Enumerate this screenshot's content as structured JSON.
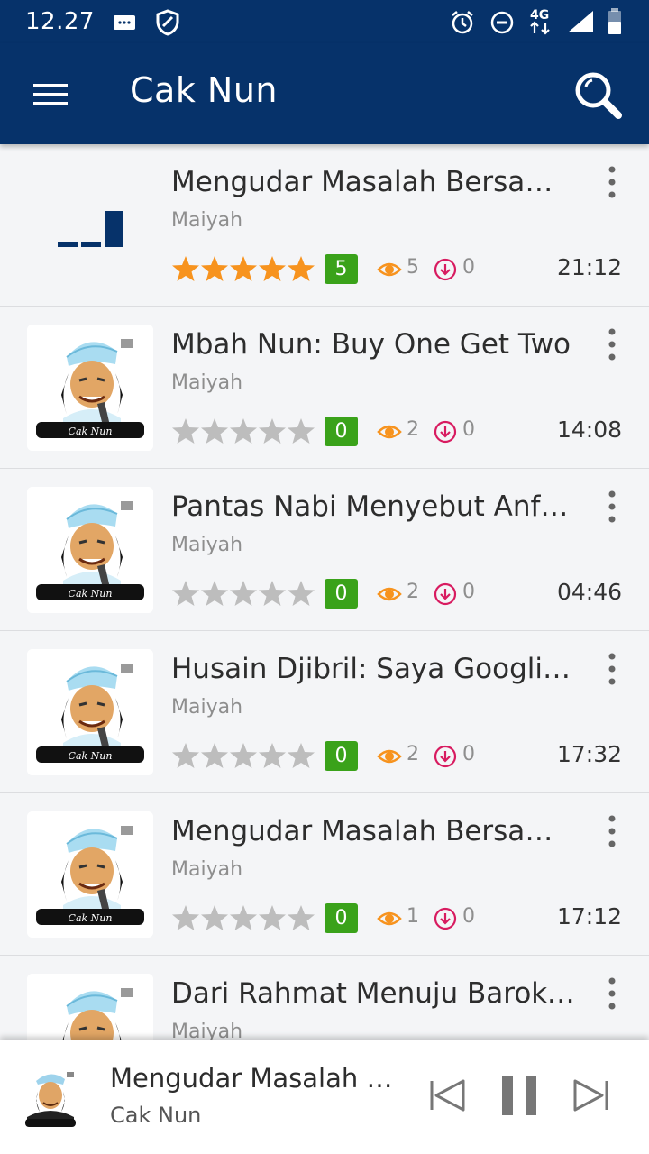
{
  "status_bar": {
    "time": "12.27",
    "network": "4G"
  },
  "app_bar": {
    "title": "Cak Nun"
  },
  "tracks": [
    {
      "title": "Mengudar Masalah Bersam...",
      "subtitle": "Maiyah",
      "rating": 5,
      "rating_label": "5",
      "views": "5",
      "downloads": "0",
      "duration": "21:12",
      "thumb": "bars-icon"
    },
    {
      "title": "Mbah Nun: Buy One Get Two",
      "subtitle": "Maiyah",
      "rating": 0,
      "rating_label": "0",
      "views": "2",
      "downloads": "0",
      "duration": "14:08",
      "thumb": "portrait"
    },
    {
      "title": "Pantas Nabi Menyebut Anfa...",
      "subtitle": "Maiyah",
      "rating": 0,
      "rating_label": "0",
      "views": "2",
      "downloads": "0",
      "duration": "04:46",
      "thumb": "portrait"
    },
    {
      "title": "Husain Djibril: Saya Googling...",
      "subtitle": "Maiyah",
      "rating": 0,
      "rating_label": "0",
      "views": "2",
      "downloads": "0",
      "duration": "17:32",
      "thumb": "portrait"
    },
    {
      "title": "Mengudar Masalah Bersam...",
      "subtitle": "Maiyah",
      "rating": 0,
      "rating_label": "0",
      "views": "1",
      "downloads": "0",
      "duration": "17:12",
      "thumb": "portrait"
    },
    {
      "title": "Dari Rahmat Menuju Baroka...",
      "subtitle": "Maiyah",
      "rating": 0,
      "rating_label": "",
      "views": "",
      "downloads": "",
      "duration": "",
      "thumb": "portrait"
    }
  ],
  "player": {
    "title": "Mengudar Masalah B...",
    "artist": "Cak Nun"
  },
  "colors": {
    "primary": "#06326a",
    "star_active": "#f7931e",
    "star_inactive": "#bdbdbd",
    "badge": "#3aa21a",
    "eye": "#f7931e",
    "download": "#d81b60"
  }
}
